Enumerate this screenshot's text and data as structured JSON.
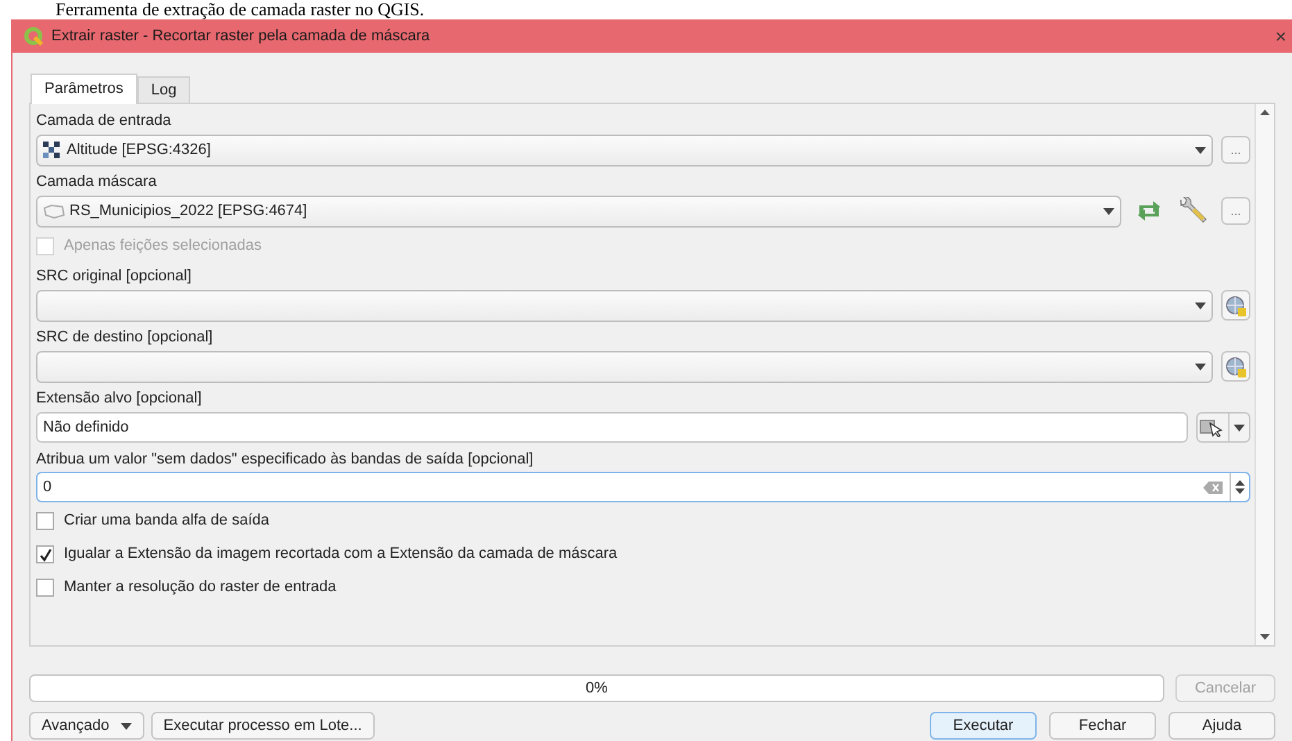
{
  "caption": "Ferramenta de extração de camada raster no QGIS.",
  "window": {
    "title": "Extrair raster - Recortar raster pela camada de máscara",
    "close": "×"
  },
  "tabs": [
    {
      "label": "Parâmetros",
      "selected": true
    },
    {
      "label": "Log",
      "selected": false
    }
  ],
  "params": [
    {
      "kind": "label",
      "text": "Camada de entrada"
    },
    {
      "kind": "raster_layer",
      "value": "Altitude [EPSG:4326]",
      "more": "...",
      "tools": false
    },
    {
      "kind": "label",
      "text": "Camada máscara"
    },
    {
      "kind": "vector_layer",
      "value": "RS_Municipios_2022 [EPSG:4674]",
      "more": "...",
      "tools": true
    },
    {
      "kind": "checkbox",
      "label": "Apenas feições selecionadas",
      "checked": false,
      "disabled": true
    },
    {
      "kind": "label",
      "text": "SRC original [opcional]"
    },
    {
      "kind": "crs_combo"
    },
    {
      "kind": "label",
      "text": "SRC de destino [opcional]"
    },
    {
      "kind": "crs_combo"
    },
    {
      "kind": "label",
      "text": "Extensão alvo [opcional]"
    },
    {
      "kind": "extent",
      "value": "Não definido"
    },
    {
      "kind": "label",
      "text": "Atribua um valor \"sem dados\" especificado às bandas de saída [opcional]"
    },
    {
      "kind": "number",
      "value": "0",
      "focused": true
    },
    {
      "kind": "checkbox",
      "label": "Criar uma banda alfa de saída",
      "checked": false,
      "disabled": false
    },
    {
      "kind": "checkbox",
      "label": "Igualar a Extensão da imagem recortada com a Extensão da camada de máscara",
      "checked": true,
      "disabled": false
    },
    {
      "kind": "checkbox",
      "label": "Manter a resolução do raster de entrada",
      "checked": false,
      "disabled": false
    }
  ],
  "progress": {
    "level": 0,
    "text": "0%"
  },
  "cancel": {
    "label": "Cancelar",
    "disabled": true
  },
  "left_buttons": [
    {
      "label": "Avançado",
      "dropdown": true
    },
    {
      "label": "Executar processo em Lote...",
      "dropdown": false
    }
  ],
  "right_buttons": [
    {
      "label": "Executar",
      "default": true
    },
    {
      "label": "Fechar",
      "default": false
    },
    {
      "label": "Ajuda",
      "default": false
    }
  ]
}
